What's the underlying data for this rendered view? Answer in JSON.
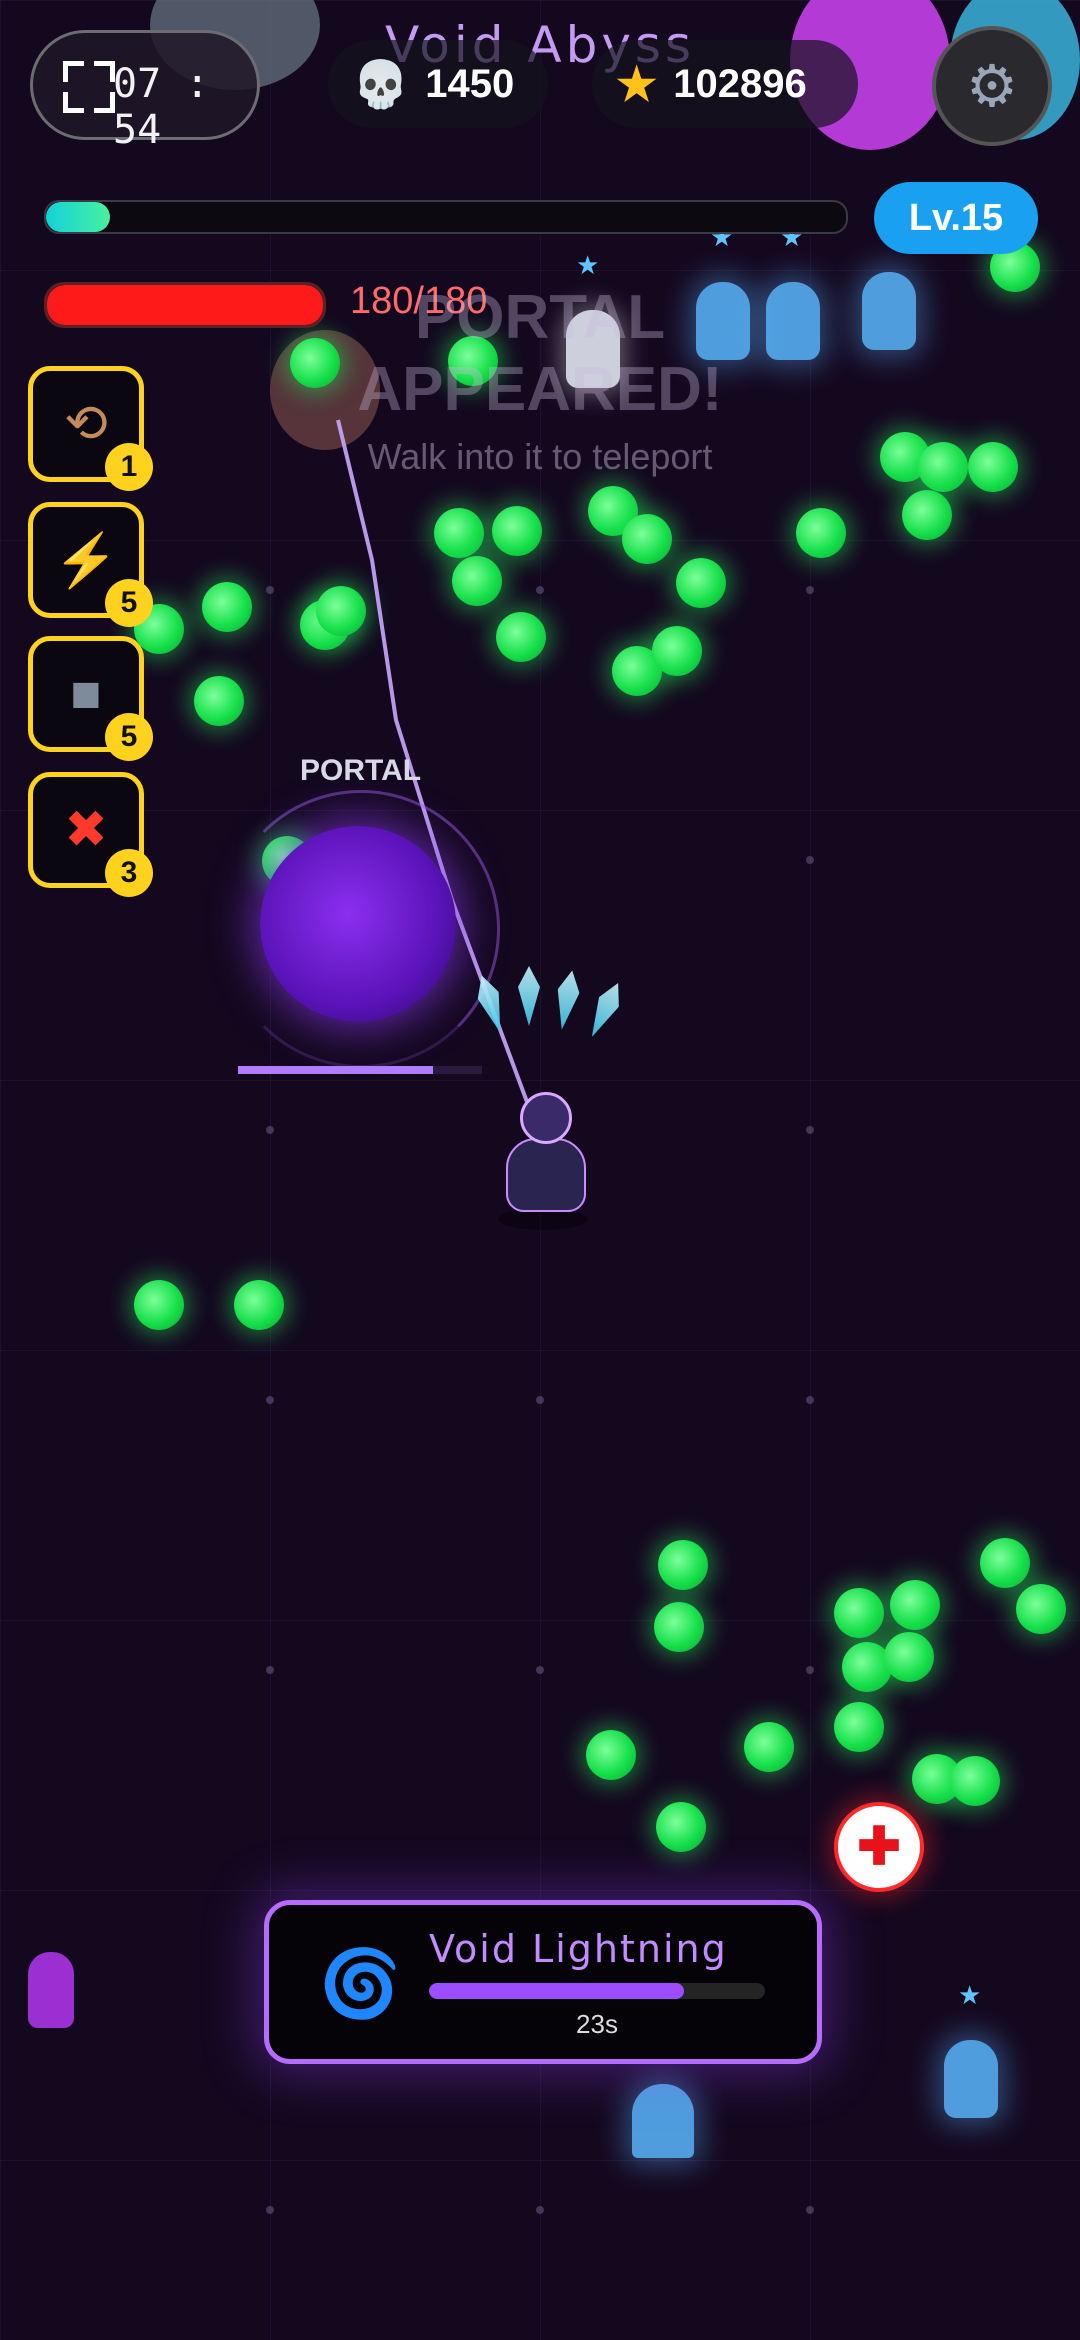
{
  "hud": {
    "timer": "07 : 54",
    "kills": "1450",
    "kills_icon": "skull-icon",
    "stars": "102896",
    "stars_icon": "star-icon",
    "level_name": "Void Abyss",
    "settings_icon": "gear-icon",
    "xp_progress": 0.08,
    "level_badge": "Lv.15",
    "hp_text": "180/180",
    "hp_fraction": 1.0
  },
  "announcement": {
    "line1": "PORTAL",
    "line2": "APPEARED!",
    "line3": "Walk into it to teleport"
  },
  "skills": [
    {
      "icon": "boomerang-icon",
      "level": "1"
    },
    {
      "icon": "lightning-icon",
      "level": "5"
    },
    {
      "icon": "cube-icon",
      "level": "5"
    },
    {
      "icon": "anger-icon",
      "level": "3"
    }
  ],
  "portal": {
    "label": "PORTAL",
    "progress": 0.8
  },
  "ability": {
    "icon": "vortex-icon",
    "name": "Void Lightning",
    "progress": 0.76,
    "timer": "23s"
  },
  "colors": {
    "background": "#14081f",
    "xp": "#12d2d8",
    "hp": "#ff1a1a",
    "level_badge": "#1aa0f0",
    "skill_border": "#ffd21e",
    "ability_border": "#b86bff"
  }
}
